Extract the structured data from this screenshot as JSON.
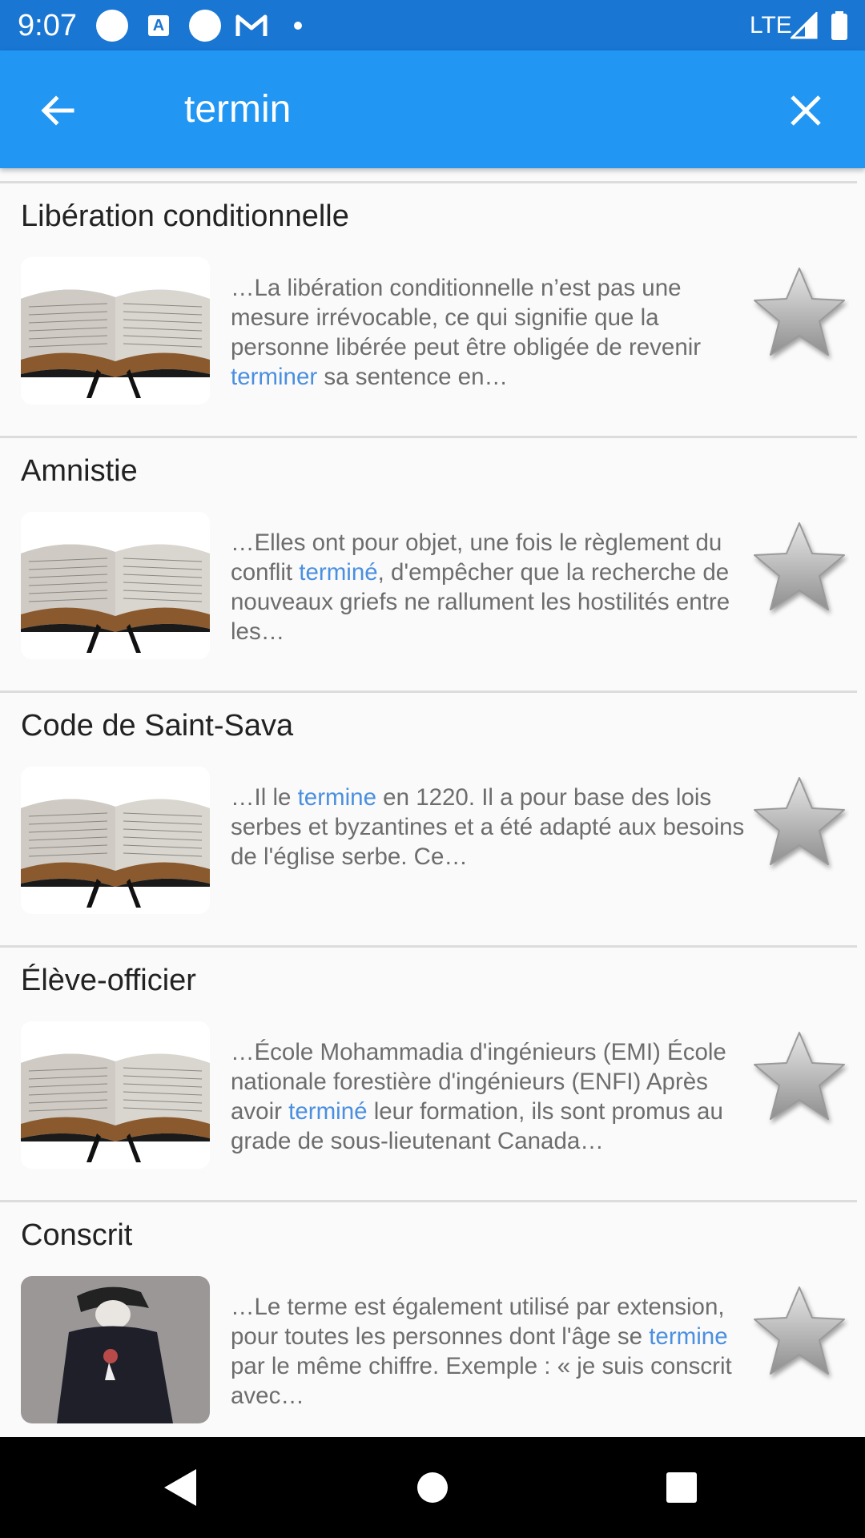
{
  "status_bar": {
    "time": "9:07",
    "network": "LTE",
    "icons": [
      "circle-notification-icon",
      "a-notification-icon",
      "circle-notification-icon",
      "gmail-icon",
      "dot-icon",
      "signal-icon",
      "battery-icon"
    ]
  },
  "app_bar": {
    "search_query": "termin",
    "back_icon": "arrow-left-icon",
    "close_icon": "close-icon",
    "color": "#2196F3"
  },
  "results": [
    {
      "title": "Libération conditionnelle",
      "thumb": "book",
      "snippet_pre": "…La libération conditionnelle n’est pas une mesure irrévocable, ce qui signifie que la personne libérée peut être obligée de revenir ",
      "snippet_hl": "terminer",
      "snippet_post": " sa sentence en…"
    },
    {
      "title": "Amnistie",
      "thumb": "book",
      "snippet_pre": "…Elles ont pour objet, une fois le règlement du conflit ",
      "snippet_hl": "terminé",
      "snippet_post": ", d'empêcher que la recherche de nouveaux griefs ne rallument les hostilités entre les…"
    },
    {
      "title": "Code de Saint-Sava",
      "thumb": "book",
      "snippet_pre": "…Il le ",
      "snippet_hl": "termine",
      "snippet_post": " en 1220. Il a pour base des lois serbes et byzantines et a été adapté aux besoins de l'église serbe. Ce…"
    },
    {
      "title": "Élève-officier",
      "thumb": "book",
      "snippet_pre": "…École Mohammadia d'ingénieurs (EMI) École nationale forestière d'ingénieurs (ENFI) Après avoir ",
      "snippet_hl": "terminé",
      "snippet_post": " leur formation, ils sont promus au grade de sous-lieutenant Canada…"
    },
    {
      "title": "Conscrit",
      "thumb": "person",
      "snippet_pre": "…Le terme est également utilisé par extension, pour toutes les personnes dont l'âge se ",
      "snippet_hl": "termine",
      "snippet_post": " par le même chiffre. Exemple : « je suis conscrit avec…"
    }
  ],
  "nav_bar": {
    "icons": [
      "back-triangle-icon",
      "home-circle-icon",
      "recents-square-icon"
    ]
  },
  "colors": {
    "status_bar": "#1976D2",
    "highlight": "#4a8fe0",
    "snippet_text": "#6d6d6d"
  }
}
